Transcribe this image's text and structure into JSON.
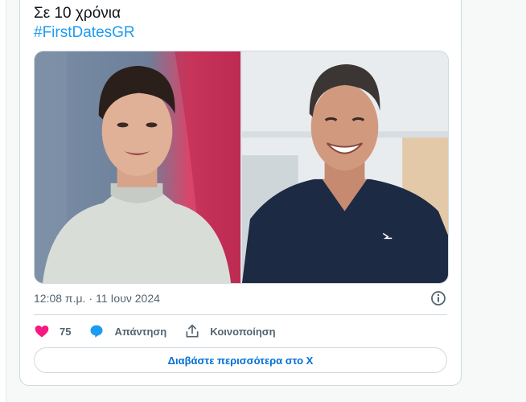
{
  "tweet": {
    "text_line1": "Σε 10 χρόνια",
    "hashtag": "#FirstDatesGR",
    "timestamp_time": "12:08 π.μ.",
    "timestamp_separator": "·",
    "timestamp_date": "11 Ιουν 2024"
  },
  "actions": {
    "like_count": "75",
    "reply_label": "Απάντηση",
    "share_label": "Κοινοποίηση"
  },
  "read_more_label": "Διαβάστε περισσότερα στο X",
  "colors": {
    "accent": "#1d9bf0",
    "like": "#f91880",
    "link": "#006fd6",
    "muted": "#536471"
  },
  "icons": [
    "heart-icon",
    "reply-bubble-icon",
    "share-icon",
    "info-icon"
  ]
}
